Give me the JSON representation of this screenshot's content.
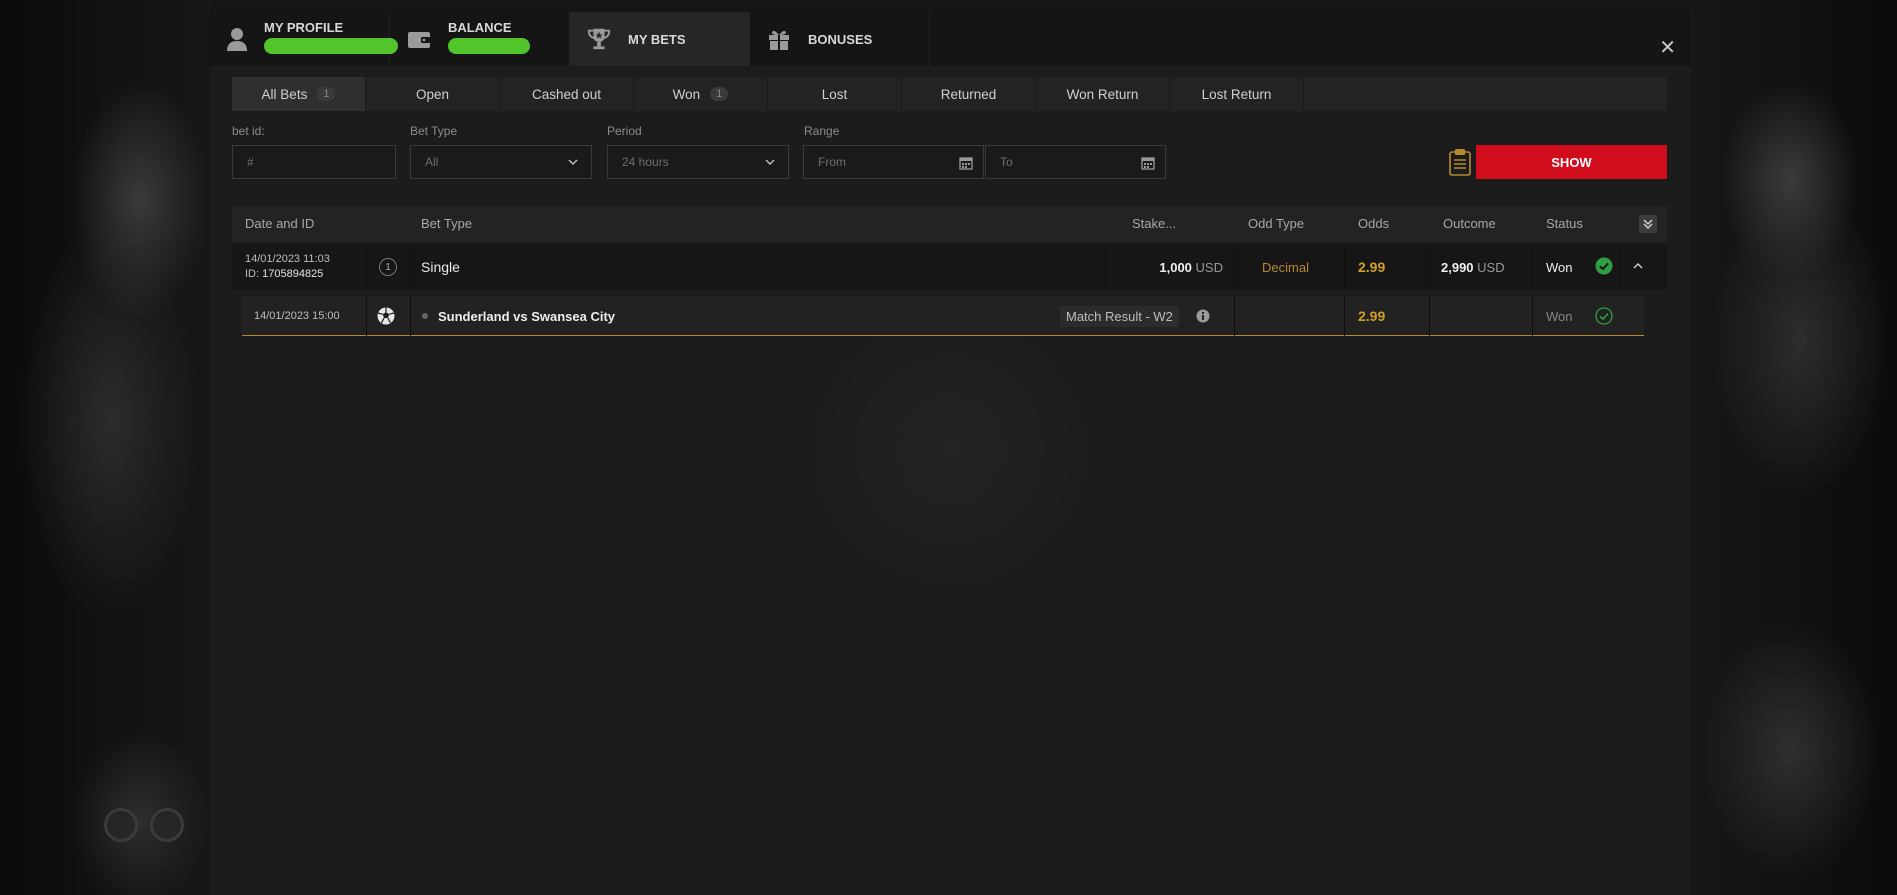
{
  "header": {
    "tabs": [
      {
        "label": "MY PROFILE",
        "icon": "user-icon"
      },
      {
        "label": "BALANCE",
        "icon": "wallet-icon"
      },
      {
        "label": "MY BETS",
        "icon": "trophy-icon"
      },
      {
        "label": "BONUSES",
        "icon": "gift-icon"
      }
    ],
    "close": "✕"
  },
  "filter_tabs": [
    {
      "label": "All Bets",
      "count": "1"
    },
    {
      "label": "Open",
      "count": ""
    },
    {
      "label": "Cashed out",
      "count": ""
    },
    {
      "label": "Won",
      "count": "1"
    },
    {
      "label": "Lost",
      "count": ""
    },
    {
      "label": "Returned",
      "count": ""
    },
    {
      "label": "Won Return",
      "count": ""
    },
    {
      "label": "Lost Return",
      "count": ""
    }
  ],
  "filters": {
    "bet_id_label": "bet id:",
    "bet_id_placeholder": "#",
    "bet_type_label": "Bet Type",
    "bet_type_value": "All",
    "period_label": "Period",
    "period_value": "24 hours",
    "range_label": "Range",
    "from_placeholder": "From",
    "to_placeholder": "To",
    "show_label": "SHOW"
  },
  "table": {
    "columns": [
      "Date and ID",
      "Bet Type",
      "Stake...",
      "Odd Type",
      "Odds",
      "Outcome",
      "Status"
    ],
    "bet": {
      "date": "14/01/2023 11:03",
      "id_label": "ID:",
      "id": "1705894825",
      "type_index": "1",
      "type": "Single",
      "stake": "1,000",
      "stake_currency": "USD",
      "odd_type": "Decimal",
      "odds": "2.99",
      "outcome": "2,990",
      "outcome_currency": "USD",
      "status": "Won"
    },
    "selection": {
      "date": "14/01/2023 15:00",
      "event": "Sunderland vs Swansea City",
      "market": "Match Result - W2",
      "odds": "2.99",
      "status": "Won"
    }
  },
  "colors": {
    "accent_red": "#d10c1c",
    "gold": "#d1a021",
    "won_green": "#2ea043"
  }
}
